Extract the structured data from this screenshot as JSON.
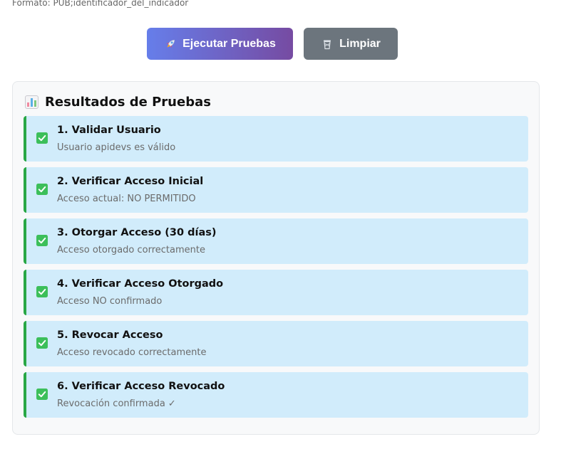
{
  "format_hint": "Formato: PUB;identificador_del_indicador",
  "buttons": {
    "run": {
      "label": "Ejecutar Pruebas",
      "icon": "rocket-icon"
    },
    "clear": {
      "label": "Limpiar",
      "icon": "trash-icon"
    }
  },
  "results": {
    "title": "Resultados de Pruebas",
    "title_icon": "bar-chart-icon",
    "items": [
      {
        "title": "1. Validar Usuario",
        "detail": "Usuario apidevs es válido",
        "status": "passed"
      },
      {
        "title": "2. Verificar Acceso Inicial",
        "detail": "Acceso actual: NO PERMITIDO",
        "status": "passed"
      },
      {
        "title": "3. Otorgar Acceso (30 días)",
        "detail": "Acceso otorgado correctamente",
        "status": "passed"
      },
      {
        "title": "4. Verificar Acceso Otorgado",
        "detail": "Acceso NO confirmado",
        "status": "passed"
      },
      {
        "title": "5. Revocar Acceso",
        "detail": "Acceso revocado correctamente",
        "status": "passed"
      },
      {
        "title": "6. Verificar Acceso Revocado",
        "detail": "Revocación confirmada ✓",
        "status": "passed"
      }
    ]
  },
  "colors": {
    "run_gradient_start": "#667eea",
    "run_gradient_end": "#764ba2",
    "clear_button": "#6c757d",
    "result_bg": "#d1ecfb",
    "result_border": "#28a745",
    "check_green": "#3cbf5a"
  }
}
